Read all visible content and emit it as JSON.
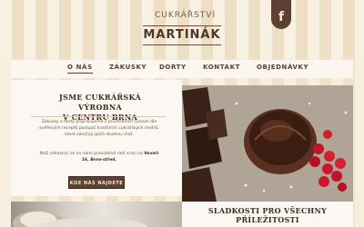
{
  "header": {
    "logo_top": "CUKRÁŘSTVÍ",
    "logo_main": "MARTINÁK",
    "facebook_glyph": "f"
  },
  "nav": {
    "items": [
      {
        "label": "O NÁS",
        "active": true
      },
      {
        "label": "ZÁKUSKY",
        "active": false
      },
      {
        "label": "DORTY",
        "active": false
      },
      {
        "label": "KONTAKT",
        "active": false
      },
      {
        "label": "OBJEDNÁVKY",
        "active": false
      }
    ]
  },
  "intro": {
    "title_line1": "JSME CUKRÁŘSKÁ VÝROBNA",
    "title_line2": "V CENTRU BRNA",
    "paragraph1": "Zákusky a dorty připravujeme z prvotřídních surovin dle ověřených receptů postupů tradičních cukrářských mistrů, které zaručují jejich skvělou chuť.",
    "paragraph2_prefix": "Naši zákazníci se na námi pravidelně rádi vrací na",
    "paragraph2_bold": "Veveří 16, Brno-střed.",
    "cta_label": "KDE NÁS NAJDETE"
  },
  "promo": {
    "title_line1": "SLADKOSTI PRO VŠECHNY",
    "title_line2": "PŘÍLEŽITOSTI"
  },
  "colors": {
    "brand_brown": "#5c4132",
    "stripe_light": "#f8f0e1",
    "stripe_dark": "#ecdfc4"
  }
}
